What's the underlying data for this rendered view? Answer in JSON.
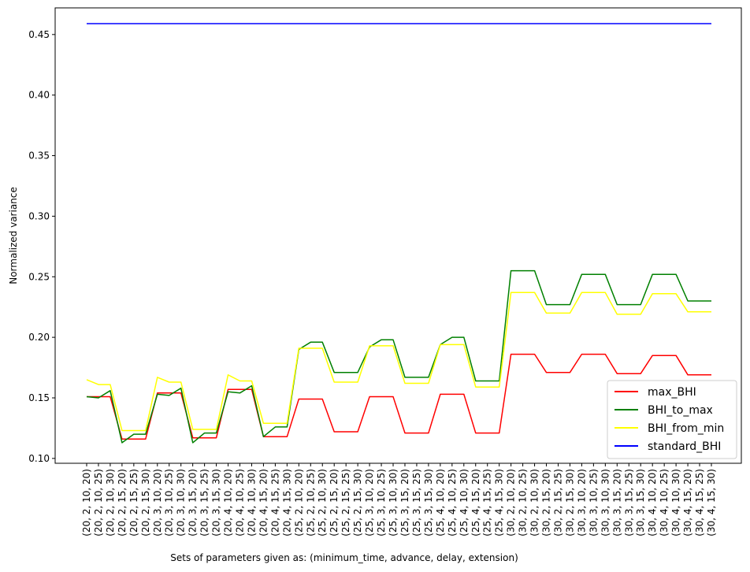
{
  "chart_data": {
    "type": "line",
    "xlabel": "Sets of parameters given as: (minimum_time, advance, delay, extension)",
    "ylabel": "Normalized variance",
    "ylim": [
      0.096,
      0.472
    ],
    "yticks": [
      "0.10",
      "0.15",
      "0.20",
      "0.25",
      "0.30",
      "0.35",
      "0.40",
      "0.45"
    ],
    "grid": false,
    "legend_position": "lower-right",
    "categories": [
      "(20, 2, 10, 20)",
      "(20, 2, 10, 25)",
      "(20, 2, 10, 30)",
      "(20, 2, 15, 20)",
      "(20, 2, 15, 25)",
      "(20, 2, 15, 30)",
      "(20, 3, 10, 20)",
      "(20, 3, 10, 25)",
      "(20, 3, 10, 30)",
      "(20, 3, 15, 20)",
      "(20, 3, 15, 25)",
      "(20, 3, 15, 30)",
      "(20, 4, 10, 20)",
      "(20, 4, 10, 25)",
      "(20, 4, 10, 30)",
      "(20, 4, 15, 20)",
      "(20, 4, 15, 25)",
      "(20, 4, 15, 30)",
      "(25, 2, 10, 20)",
      "(25, 2, 10, 25)",
      "(25, 2, 10, 30)",
      "(25, 2, 15, 20)",
      "(25, 2, 15, 25)",
      "(25, 2, 15, 30)",
      "(25, 3, 10, 20)",
      "(25, 3, 10, 25)",
      "(25, 3, 10, 30)",
      "(25, 3, 15, 20)",
      "(25, 3, 15, 25)",
      "(25, 3, 15, 30)",
      "(25, 4, 10, 20)",
      "(25, 4, 10, 25)",
      "(25, 4, 10, 30)",
      "(25, 4, 15, 20)",
      "(25, 4, 15, 25)",
      "(25, 4, 15, 30)",
      "(30, 2, 10, 20)",
      "(30, 2, 10, 25)",
      "(30, 2, 10, 30)",
      "(30, 2, 15, 20)",
      "(30, 2, 15, 25)",
      "(30, 2, 15, 30)",
      "(30, 3, 10, 20)",
      "(30, 3, 10, 25)",
      "(30, 3, 10, 30)",
      "(30, 3, 15, 20)",
      "(30, 3, 15, 25)",
      "(30, 3, 15, 30)",
      "(30, 4, 10, 20)",
      "(30, 4, 10, 25)",
      "(30, 4, 10, 30)",
      "(30, 4, 15, 20)",
      "(30, 4, 15, 25)",
      "(30, 4, 15, 30)"
    ],
    "series": [
      {
        "name": "max_BHI",
        "color": "#ff0000",
        "values": [
          0.151,
          0.151,
          0.151,
          0.116,
          0.116,
          0.116,
          0.154,
          0.154,
          0.154,
          0.117,
          0.117,
          0.117,
          0.157,
          0.157,
          0.157,
          0.118,
          0.118,
          0.118,
          0.149,
          0.149,
          0.149,
          0.122,
          0.122,
          0.122,
          0.151,
          0.151,
          0.151,
          0.121,
          0.121,
          0.121,
          0.153,
          0.153,
          0.153,
          0.121,
          0.121,
          0.121,
          0.186,
          0.186,
          0.186,
          0.171,
          0.171,
          0.171,
          0.186,
          0.186,
          0.186,
          0.17,
          0.17,
          0.17,
          0.185,
          0.185,
          0.185,
          0.169,
          0.169,
          0.169
        ]
      },
      {
        "name": "BHI_to_max",
        "color": "#008000",
        "values": [
          0.151,
          0.15,
          0.156,
          0.113,
          0.12,
          0.12,
          0.153,
          0.152,
          0.158,
          0.113,
          0.121,
          0.121,
          0.155,
          0.154,
          0.16,
          0.118,
          0.126,
          0.126,
          0.19,
          0.196,
          0.196,
          0.171,
          0.171,
          0.171,
          0.192,
          0.198,
          0.198,
          0.167,
          0.167,
          0.167,
          0.194,
          0.2,
          0.2,
          0.164,
          0.164,
          0.164,
          0.255,
          0.255,
          0.255,
          0.227,
          0.227,
          0.227,
          0.252,
          0.252,
          0.252,
          0.227,
          0.227,
          0.227,
          0.252,
          0.252,
          0.252,
          0.23,
          0.23,
          0.23
        ]
      },
      {
        "name": "BHI_from_min",
        "color": "#ffff00",
        "values": [
          0.165,
          0.161,
          0.161,
          0.123,
          0.123,
          0.123,
          0.167,
          0.163,
          0.163,
          0.124,
          0.124,
          0.124,
          0.169,
          0.164,
          0.164,
          0.129,
          0.129,
          0.129,
          0.191,
          0.191,
          0.191,
          0.163,
          0.163,
          0.163,
          0.193,
          0.193,
          0.193,
          0.162,
          0.162,
          0.162,
          0.194,
          0.194,
          0.194,
          0.159,
          0.159,
          0.159,
          0.237,
          0.237,
          0.237,
          0.22,
          0.22,
          0.22,
          0.237,
          0.237,
          0.237,
          0.219,
          0.219,
          0.219,
          0.236,
          0.236,
          0.236,
          0.221,
          0.221,
          0.221
        ]
      },
      {
        "name": "standard_BHI",
        "color": "#0000ff",
        "values": [
          0.459,
          0.459,
          0.459,
          0.459,
          0.459,
          0.459,
          0.459,
          0.459,
          0.459,
          0.459,
          0.459,
          0.459,
          0.459,
          0.459,
          0.459,
          0.459,
          0.459,
          0.459,
          0.459,
          0.459,
          0.459,
          0.459,
          0.459,
          0.459,
          0.459,
          0.459,
          0.459,
          0.459,
          0.459,
          0.459,
          0.459,
          0.459,
          0.459,
          0.459,
          0.459,
          0.459,
          0.459,
          0.459,
          0.459,
          0.459,
          0.459,
          0.459,
          0.459,
          0.459,
          0.459,
          0.459,
          0.459,
          0.459,
          0.459,
          0.459,
          0.459,
          0.459,
          0.459,
          0.459
        ]
      }
    ]
  }
}
